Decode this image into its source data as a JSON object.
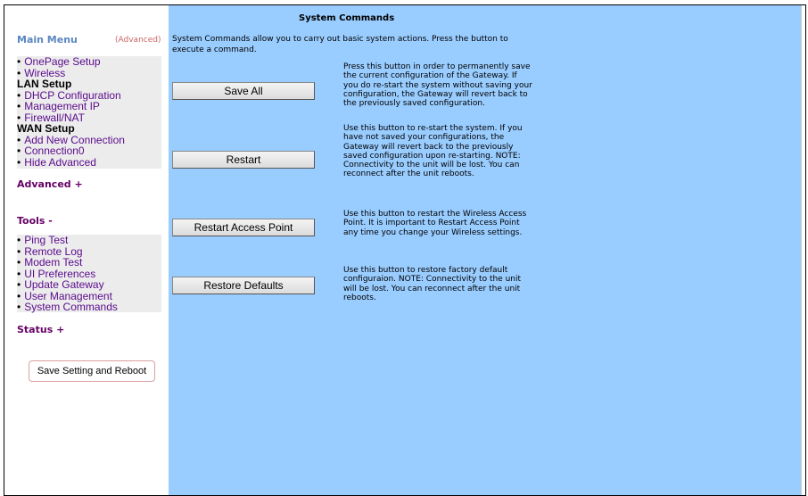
{
  "sidebar": {
    "main_menu_title": "Main Menu",
    "advanced_tag": "(Advanced)",
    "setup_items": [
      "OnePage Setup",
      "Wireless"
    ],
    "lan_setup_title": "LAN Setup",
    "lan_items": [
      "DHCP Configuration",
      "Management IP",
      "Firewall/NAT"
    ],
    "wan_setup_title": "WAN Setup",
    "wan_items": [
      "Add New Connection",
      "Connection0",
      "Hide Advanced"
    ],
    "advanced_section": "Advanced +",
    "tools_section": "Tools -",
    "tools_items": [
      "Ping Test",
      "Remote Log",
      "Modem Test",
      "UI Preferences",
      "Update Gateway",
      "User Management",
      "System Commands"
    ],
    "status_section": "Status +",
    "save_reboot_label": "Save Setting and Reboot",
    "bullet": "•"
  },
  "main": {
    "title": "System Commands",
    "intro": "System Commands allow you to carry out basic system actions. Press the button to execute a command.",
    "commands": [
      {
        "label": "Save All",
        "description": "Press this button in order to permanently save the current configuration of the Gateway. If you do re-start the system without saving your configuration, the Gateway will revert back to the previously saved configuration."
      },
      {
        "label": "Restart",
        "description": "Use this button to re-start the system. If you have not saved your configurations, the Gateway will revert back to the previously saved configuration upon re-starting. NOTE: Connectivity to the unit will be lost. You can reconnect after the unit reboots."
      },
      {
        "label": "Restart Access Point",
        "description": "Use this button to restart the Wireless Access Point. It is important to Restart Access Point any time you change your Wireless settings."
      },
      {
        "label": "Restore Defaults",
        "description": "Use this button to restore factory default configuraion. NOTE: Connectivity to the unit will be lost. You can reconnect after the unit reboots."
      }
    ]
  },
  "colors": {
    "content_bg": "#99ccff",
    "menu_group_bg": "#ececec",
    "link": "#5a0a8c",
    "main_menu_title": "#5b87c1",
    "section_head": "#660066",
    "advanced_tag": "#cc6666"
  }
}
